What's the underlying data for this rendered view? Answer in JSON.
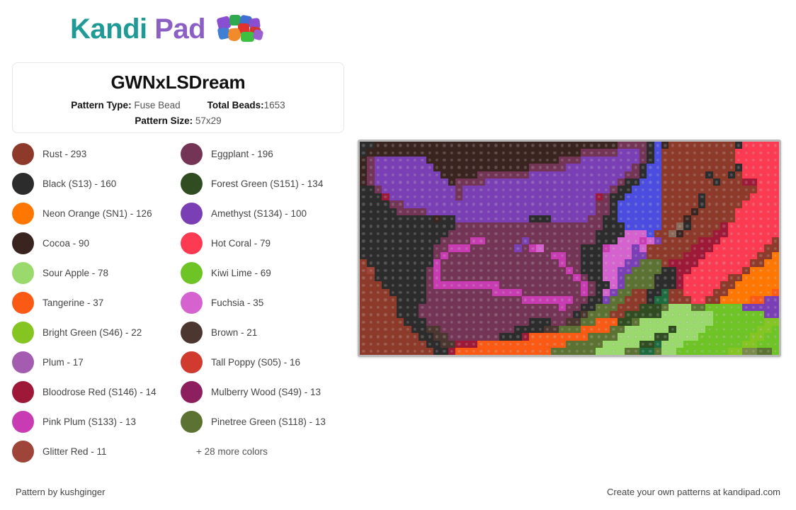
{
  "header": {
    "logo_text_1": "Kandi",
    "logo_text_2": "Pad",
    "logo_icon": "bead-cluster-icon",
    "brand_teal": "#1f9a96",
    "brand_purple": "#8b5fc4"
  },
  "card": {
    "title": "GWNxLSDream",
    "pattern_type_label": "Pattern Type:",
    "pattern_type_value": "Fuse Bead",
    "total_beads_label": "Total Beads:",
    "total_beads_value": "1653",
    "pattern_size_label": "Pattern Size:",
    "pattern_size_value": "57x29"
  },
  "legend": {
    "more_colors": "+ 28 more colors",
    "items": [
      {
        "name": "Rust - 293",
        "color": "#8e3a2a"
      },
      {
        "name": "Eggplant - 196",
        "color": "#733455"
      },
      {
        "name": "Black (S13) - 160",
        "color": "#2c2c2c"
      },
      {
        "name": "Forest Green (S151) - 134",
        "color": "#2f4d21"
      },
      {
        "name": "Neon Orange (SN1) - 126",
        "color": "#ff7700"
      },
      {
        "name": "Amethyst (S134) - 100",
        "color": "#7b3fb5"
      },
      {
        "name": "Cocoa - 90",
        "color": "#3a2420"
      },
      {
        "name": "Hot Coral - 79",
        "color": "#fc3b52"
      },
      {
        "name": "Sour Apple - 78",
        "color": "#9ad96c"
      },
      {
        "name": "Kiwi Lime - 69",
        "color": "#6ec325"
      },
      {
        "name": "Tangerine - 37",
        "color": "#fa5a14"
      },
      {
        "name": "Fuchsia - 35",
        "color": "#d562cf"
      },
      {
        "name": "Bright Green (S46) - 22",
        "color": "#84c522"
      },
      {
        "name": "Brown - 21",
        "color": "#4c3630"
      },
      {
        "name": "Plum - 17",
        "color": "#a35cb0"
      },
      {
        "name": "Tall Poppy (S05) - 16",
        "color": "#d03a2f"
      },
      {
        "name": "Bloodrose Red (S146) - 14",
        "color": "#9e1838"
      },
      {
        "name": "Mulberry Wood (S49) - 13",
        "color": "#8e1f5e"
      },
      {
        "name": "Pink Plum (S133) - 13",
        "color": "#c93bb2"
      },
      {
        "name": "Pinetree Green (S118) - 13",
        "color": "#5c7233"
      },
      {
        "name": "Glitter Red - 11",
        "color": "#9e4438"
      }
    ]
  },
  "preview": {
    "cols": 57,
    "rows": 29,
    "bead_size": 10.4,
    "frame_color": "#b9b9b9",
    "palette": {
      "R": "#8e3a2a",
      "E": "#733455",
      "K": "#2c2c2c",
      "F": "#2f4d21",
      "N": "#ff7700",
      "A": "#7b3fb5",
      "C": "#3a2420",
      "H": "#fc3b52",
      "S": "#9ad96c",
      "W": "#6ec325",
      "T": "#fa5a14",
      "U": "#d562cf",
      "G": "#84c522",
      "B": "#4c3630",
      "P": "#a35cb0",
      "Y": "#d03a2f",
      "D": "#9e1838",
      "M": "#8e1f5e",
      "I": "#c93bb2",
      "J": "#5c7233",
      "L": "#9e4438",
      "V": "#4a4de0",
      "X": "#2f5f8c",
      "Z": "#1d6b3f",
      "O": "#7a8a4a",
      "Q": "#8a6a5a"
    },
    "rows_data": [
      "KKCCCCCCCCCCCCCCCCCCCCCCCCCCCCCCCCCEEEEKVCRRRRRRRRRKHHHHHNN",
      "KCCCCCCCCCCCCCCCCCCCCCCCCCCCCCEEEEEAAAEKVRRRRRRRRRRHHHHHHNN",
      "CEAAAAAAACCCCCCCCCCCCCCCCCCEEEAAAAAAAAEKVRRRRRRRRRRHHHHHHNN",
      "CEAAAAAAAACCCCCCCCCCCCCEEEEEAAAAAAAAAEKVVRRRRRRRRRRKHHHHHNN",
      "CEAAAAAAAAACCCCCEEEEEEEAAAAAAAAAAAAAEEKVVRRRRRRKRRKRHHHHHHN",
      "CEAAAAAAAAAACEEEEAAAAAAAAAAAAAAAAAAEKKVVVRRRRRRRKRRRDDHHHHN",
      "KKEAAAAAAAAAAEAAAAAAAAAAAAAAAAAAAAEKKVVVVRRRRRRRRRRRRRHHHHN",
      "KKKDAAAAAAAAAEAAAAAAAAAAAAAAAAAADEKKVVVVVRRRRRKRRRRRRHHHHHN",
      "KKKKEEAAAAAAAAAAAAAAAAAAAAAAAAAAEEKVVVVVVRRRRRKRRRRRHHHHHHH",
      "KKKKKEEEEAAAAAAAAAAAAAAAAAAAAAAAEEKVVVVVVRRRRCRRRRRHHHHHHHN",
      "KKKKKKKKKKCKKAAAAAAAAAAKKKAAAAAEEKKVVVVVVRRRCRRRRRRHHHHHHNN",
      "KKKKKKKKKKKKKEEEEEEEEEEEEEEEEEEEEKKKVVVVVRRQKRRRRDHHHHHHHNN",
      "KKKKKKKKKKKKEEEEEEEEEEEEEEEEEEEEKKKKUUUVRRQCRRRRDDHHHHHHHNN",
      "KKKKKKKKKKKEEEEIIEEEEEAEEEEEEEEEKKKUUUIUARRRRRDDDHHHHHHHRNN",
      "KKKKKKKKKKEEIIIEEEEEEAEIUEEEEEKKKIUUUAURRRRRRDDDHHHHHHHRRNN",
      "KKKKKKKKKKEIEEEEEEEEEEEEEEIIEEKKKUUUUAARRRRRDDDHHHHHHHRRNNN",
      "RKKKKKKKKKIEEEEEEEEEEEEEEEEIEEKKKUUUAAJJJRDDDDHHHHHHHRRNNNN",
      "RLKKKKKKKEIEEEEEEEEEEEEEEEEEIEKKKUUAAJJJJKKDDHHHHHHHRNNNNNN",
      "RRKKKKKKKEIEEEEEEEEEEEEEEEEEEIEKKUUAJJJJKKKDHHHHHHRRNNNNNNN",
      "RRRKKKKKKEIIIIIIIIIEEEEEEEEEEEIEKKUAJJJJKKKDHHHHHRRNNNNNNTN",
      "RRRRKKKKKEEEEEEEEEIIIIEEEEEEEEIEKUAJJRRKKZRRHHHHRRNNNNNNTTN",
      "RRRRRKKKKEEEEEEEEEEEEEIIIIIIIEEKKAJJRRRKZZRRRHHRRNNNNTTAAAU",
      "RRRRRKKKEEEEEEEEEEEEEEEEEEEIEEKKJJJRRRFFFJSSSJJWWWWWAAAAAAU",
      "RRRRRKKKEEEEEEEEEEEEEEEEEEEEEKBJJJRRFFFFFSSSSSSSWWWWWWWAAAK",
      "RRRRRRKKKEEEEEEEEEEEEEEKKKEEBBJJTTTFFJSSSSSSSSSSWWWWWWWGGKK",
      "RRRRRRRKKBBEEEEEEEEEEKKKKBBJJJTTTTJJSSSSSSFSSSSWWWWWWWGGWWZ",
      "RRRRRRRRKKBBEEEEEEEKKKDTTTTTTTTJJJJSSSSSFFSSSSWWWWWWWGGWWWW",
      "RRRRRRRRRKKBBDDDTTTTTTTTTTTTJJJJJSSSSSFFZSSSWWWWWWWWGGWWWWW",
      "RRRRRRRRRRKKDTTTTTTTTTTTTTJJJJJJSSSSJJZZJSSWWWWWWWGGOOJJWWW"
    ]
  },
  "footer": {
    "left": "Pattern by kushginger",
    "right": "Create your own patterns at kandipad.com"
  }
}
